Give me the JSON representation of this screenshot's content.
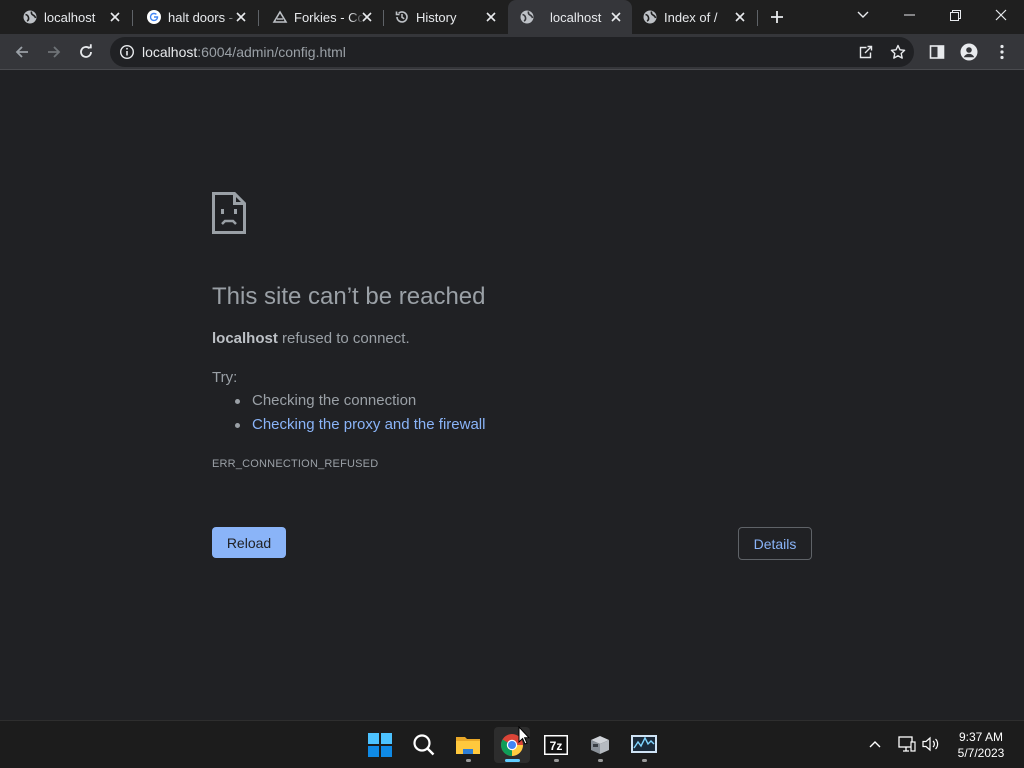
{
  "browser": {
    "tabs": [
      {
        "title": "localhost",
        "favicon": "globe-icon",
        "active": false
      },
      {
        "title": "halt doors - Google Search",
        "favicon": "google-icon",
        "active": false
      },
      {
        "title": "Forkies - Coding",
        "favicon": "forkies-icon",
        "active": false
      },
      {
        "title": "History",
        "favicon": "history-icon",
        "active": false
      },
      {
        "title": "localhost",
        "favicon": "globe-icon",
        "active": true
      },
      {
        "title": "Index of /",
        "favicon": "globe-icon",
        "active": false
      }
    ],
    "address": {
      "host": "localhost",
      "rest": ":6004/admin/config.html"
    }
  },
  "error_page": {
    "headline": "This site can’t be reached",
    "detail_host": "localhost",
    "detail_text": " refused to connect.",
    "try_label": "Try:",
    "suggestions": [
      {
        "text": "Checking the connection",
        "link": false
      },
      {
        "text": "Checking the proxy and the firewall",
        "link": true
      }
    ],
    "error_code": "ERR_CONNECTION_REFUSED",
    "reload_label": "Reload",
    "details_label": "Details"
  },
  "taskbar": {
    "apps": [
      "start-icon",
      "search-icon",
      "file-explorer-icon",
      "chrome-icon",
      "7zip-icon",
      "app-installer-icon",
      "resource-monitor-icon"
    ],
    "time": "9:37 AM",
    "date": "5/7/2023"
  },
  "colors": {
    "page_bg": "#202124",
    "toolbar_bg": "#35363a",
    "accent_blue": "#8ab4f8",
    "text_gray": "#9aa0a6"
  }
}
